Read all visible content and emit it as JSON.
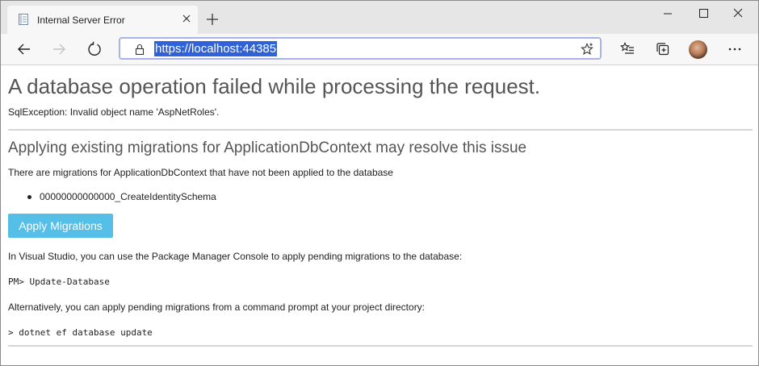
{
  "browser": {
    "tab": {
      "title": "Internal Server Error",
      "favicon": "page-icon"
    },
    "new_tab_icon": "plus-icon",
    "window_controls": [
      "minimize-icon",
      "maximize-icon",
      "close-icon"
    ],
    "toolbar": {
      "back_icon": "back-arrow-icon",
      "forward_icon": "forward-arrow-icon",
      "refresh_icon": "refresh-icon",
      "url": "https://localhost:44385",
      "favorite_icon": "star-icon",
      "favorites_icon": "favorites-list-icon",
      "collections_icon": "collections-icon",
      "menu_icon": "more-icon"
    },
    "colors": {
      "url_highlight": "#2f62d8",
      "address_border": "#aab3e6"
    }
  },
  "page": {
    "title": "A database operation failed while processing the request.",
    "exception": "SqlException: Invalid object name 'AspNetRoles'.",
    "migrations_heading": "Applying existing migrations for ApplicationDbContext may resolve this issue",
    "migrations_text": "There are migrations for ApplicationDbContext that have not been applied to the database",
    "migrations": [
      "00000000000000_CreateIdentitySchema"
    ],
    "apply_button": "Apply Migrations",
    "vs_text": "In Visual Studio, you can use the Package Manager Console to apply pending migrations to the database:",
    "pm_command": "PM> Update-Database",
    "cli_text": "Alternatively, you can apply pending migrations from a command prompt at your project directory:",
    "cli_command": "> dotnet ef database update",
    "colors": {
      "apply_button": "#56bfe8",
      "heading": "#555555",
      "divider": "#d6d6d6"
    }
  }
}
